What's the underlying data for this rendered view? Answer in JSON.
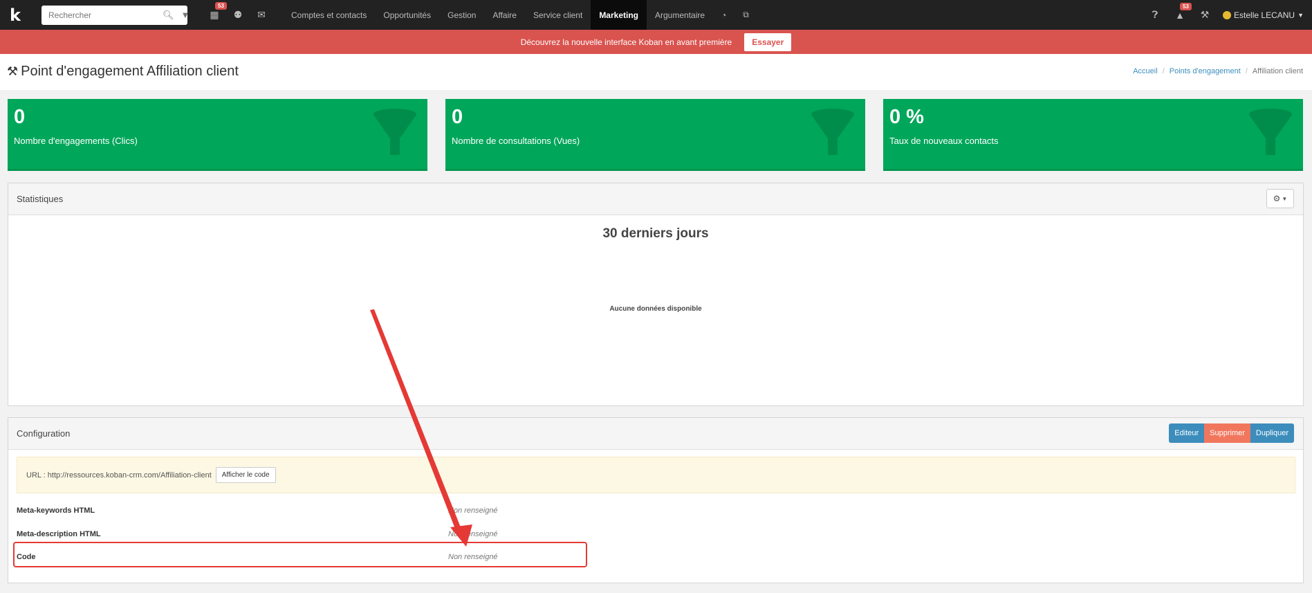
{
  "navbar": {
    "logo": "k",
    "search_placeholder": "Rechercher",
    "calendar_badge": "53",
    "notif_badge": "53",
    "links": [
      {
        "label": "Comptes et contacts",
        "active": false
      },
      {
        "label": "Opportunités",
        "active": false
      },
      {
        "label": "Gestion",
        "active": false
      },
      {
        "label": "Affaire",
        "active": false
      },
      {
        "label": "Service client",
        "active": false
      },
      {
        "label": "Marketing",
        "active": true
      },
      {
        "label": "Argumentaire",
        "active": false
      }
    ],
    "user_name": "Estelle LECANU"
  },
  "banner": {
    "text": "Découvrez la nouvelle interface Koban en avant première",
    "button": "Essayer"
  },
  "page": {
    "title": "Point d'engagement Affiliation client",
    "breadcrumb": [
      "Accueil",
      "Points d'engagement",
      "Affiliation client"
    ]
  },
  "stats": [
    {
      "value": "0",
      "label": "Nombre d'engagements (Clics)"
    },
    {
      "value": "0",
      "label": "Nombre de consultations (Vues)"
    },
    {
      "value": "0 %",
      "label": "Taux de nouveaux contacts"
    }
  ],
  "statistics_panel": {
    "title": "Statistiques",
    "chart_title": "30 derniers jours",
    "no_data": "Aucune données disponible"
  },
  "config_panel": {
    "title": "Configuration",
    "buttons": {
      "edit": "Editeur",
      "delete": "Supprimer",
      "duplicate": "Dupliquer"
    },
    "url_text": "URL : http://ressources.koban-crm.com/Affiliation-client",
    "url_button": "Afficher le code",
    "fields": [
      {
        "key": "Meta-keywords HTML",
        "value": "Non renseigné"
      },
      {
        "key": "Meta-description HTML",
        "value": "Non renseigné"
      },
      {
        "key": "Code",
        "value": "Non renseigné"
      }
    ]
  },
  "colors": {
    "navbar": "#222222",
    "banner": "#d9534f",
    "stat_green": "#00a65a",
    "primary": "#3c8dbc",
    "danger_soft": "#f0775d",
    "annotation_red": "#e53935"
  }
}
